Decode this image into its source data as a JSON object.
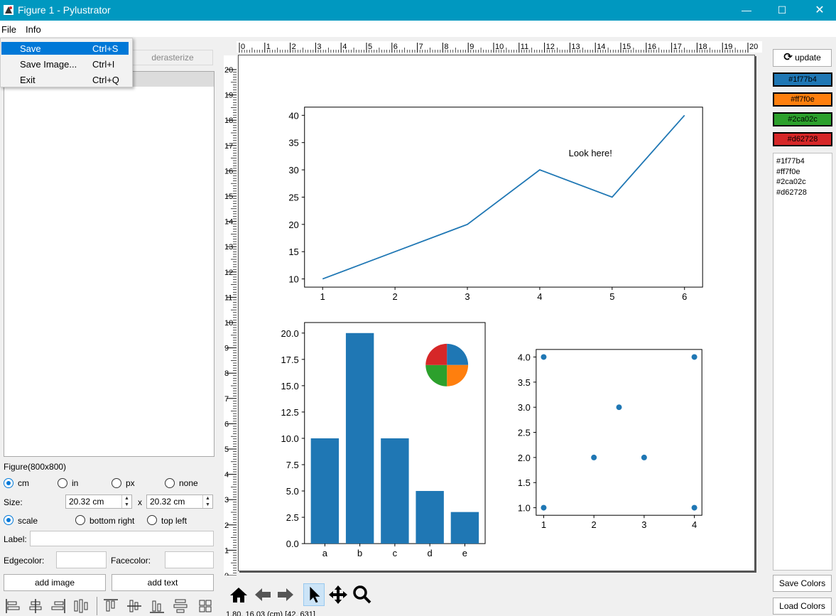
{
  "window": {
    "title": "Figure 1 - Pylustrator",
    "minimize": "—",
    "maximize": "☐",
    "close": "✕"
  },
  "menubar": {
    "file": "File",
    "info": "Info"
  },
  "file_menu": [
    {
      "label": "Save",
      "shortcut": "Ctrl+S",
      "highlighted": true
    },
    {
      "label": "Save Image...",
      "shortcut": "Ctrl+I"
    },
    {
      "label": "Exit",
      "shortcut": "Ctrl+Q"
    }
  ],
  "left_panel": {
    "derasterize": "derasterize",
    "figure_label": "Figure(800x800)",
    "units": [
      "cm",
      "in",
      "px",
      "none"
    ],
    "selected_unit": "cm",
    "size_label": "Size:",
    "size_w": "20.32 cm",
    "size_x": "x",
    "size_h": "20.32 cm",
    "anchors": [
      "scale",
      "bottom right",
      "top left"
    ],
    "selected_anchor": "scale",
    "label_label": "Label:",
    "label_value": "",
    "edgecolor_label": "Edgecolor:",
    "facecolor_label": "Facecolor:",
    "add_image": "add image",
    "add_text": "add text"
  },
  "ruler_top": [
    "0",
    "1",
    "2",
    "3",
    "4",
    "5",
    "6",
    "7",
    "8",
    "9",
    "10",
    "11",
    "12",
    "13",
    "14",
    "15",
    "16",
    "17",
    "18",
    "19",
    "20"
  ],
  "ruler_left": [
    "20",
    "19",
    "18",
    "17",
    "16",
    "15",
    "14",
    "13",
    "12",
    "11",
    "10",
    "9",
    "8",
    "7",
    "6",
    "5",
    "4",
    "3",
    "2",
    "1",
    "0"
  ],
  "right_panel": {
    "update": "update",
    "colors": [
      "#1f77b4",
      "#ff7f0e",
      "#2ca02c",
      "#d62728"
    ],
    "color_list": [
      "#1f77b4",
      "#ff7f0e",
      "#2ca02c",
      "#d62728"
    ],
    "save_colors": "Save Colors",
    "load_colors": "Load Colors"
  },
  "status_text": "1.80, 16.03 (cm) [42, 631]",
  "chart_data": [
    {
      "type": "line",
      "x": [
        1,
        2,
        3,
        4,
        5,
        6
      ],
      "y": [
        10,
        15,
        20,
        30,
        25,
        40
      ],
      "xlim": [
        0.75,
        6.25
      ],
      "ylim": [
        8.5,
        41.5
      ],
      "xticks": [
        1,
        2,
        3,
        4,
        5,
        6
      ],
      "yticks": [
        10,
        15,
        20,
        25,
        30,
        35,
        40
      ],
      "color": "#1f77b4",
      "annotation": {
        "text": "Look here!",
        "x": 4.7,
        "y": 33
      }
    },
    {
      "type": "bar",
      "categories": [
        "a",
        "b",
        "c",
        "d",
        "e"
      ],
      "values": [
        10,
        20,
        10,
        5,
        3
      ],
      "ylim": [
        0,
        21
      ],
      "yticks": [
        "0.0",
        "2.5",
        "5.0",
        "7.5",
        "10.0",
        "12.5",
        "15.0",
        "17.5",
        "20.0"
      ],
      "color": "#1f77b4"
    },
    {
      "type": "pie",
      "values": [
        1,
        1,
        1,
        1
      ],
      "colors": [
        "#1f77b4",
        "#ff7f0e",
        "#2ca02c",
        "#d62728"
      ]
    },
    {
      "type": "scatter",
      "x": [
        1,
        4,
        2.5,
        2,
        3,
        1,
        4
      ],
      "y": [
        4,
        4,
        3,
        2,
        2,
        1,
        1
      ],
      "xlim": [
        0.85,
        4.15
      ],
      "ylim": [
        0.85,
        4.15
      ],
      "xticks": [
        "1",
        "2",
        "3",
        "4"
      ],
      "yticks": [
        "1.0",
        "1.5",
        "2.0",
        "2.5",
        "3.0",
        "3.5",
        "4.0"
      ],
      "color": "#1f77b4"
    }
  ]
}
